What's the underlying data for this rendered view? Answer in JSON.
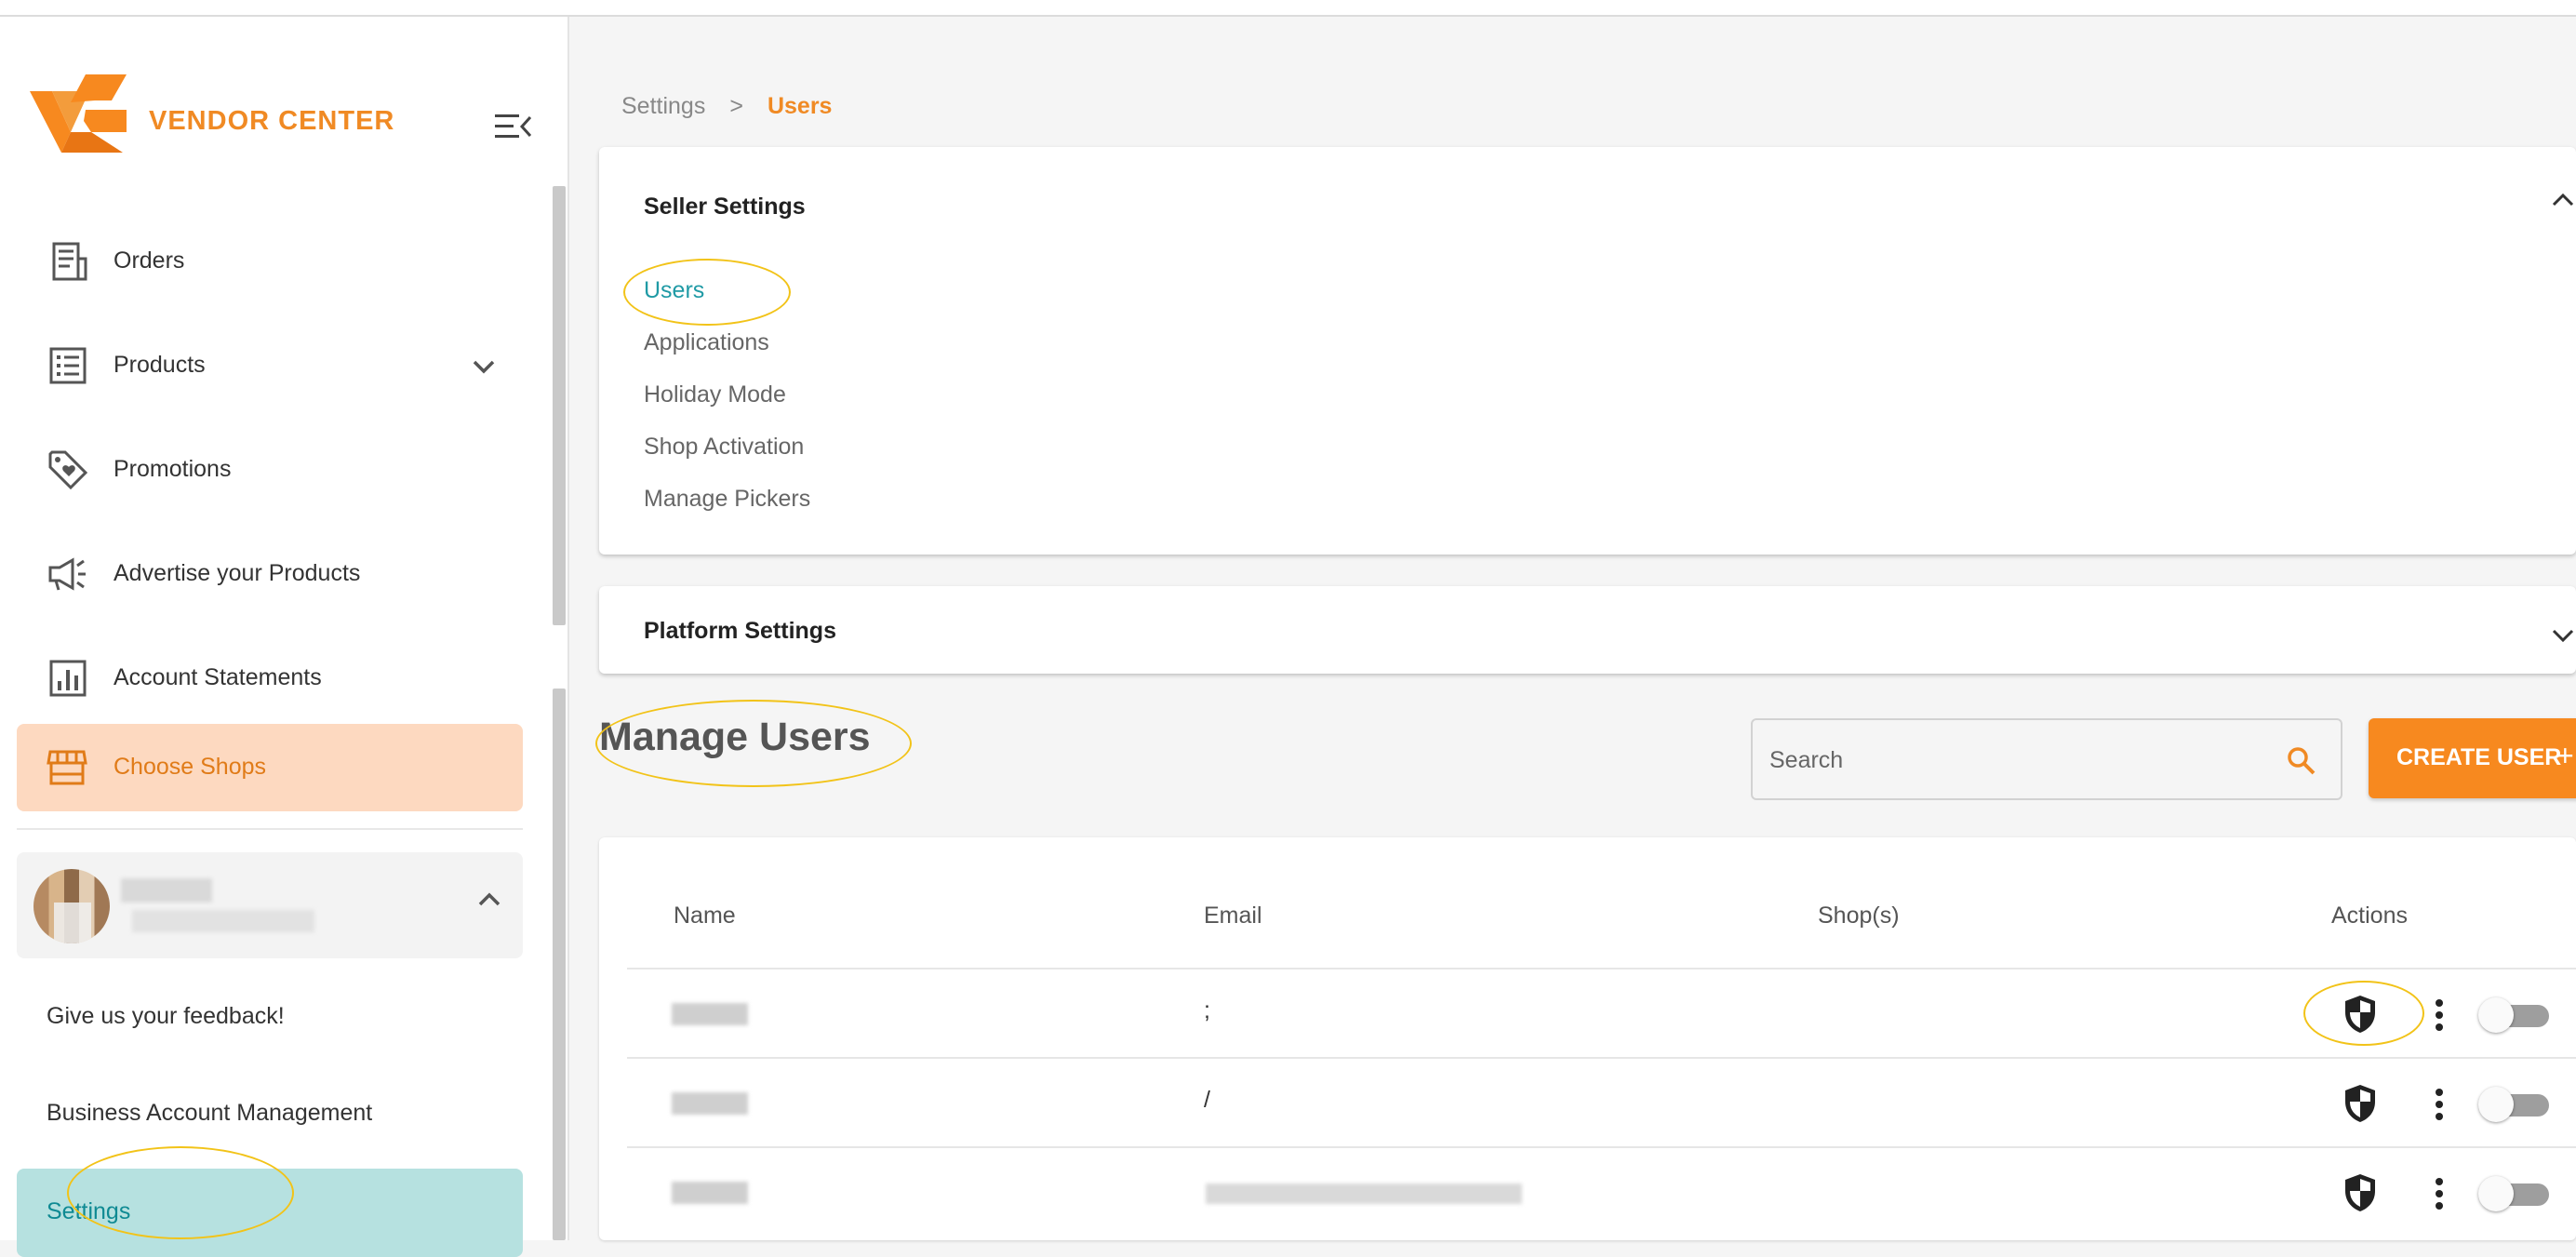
{
  "app": {
    "brand": "VENDOR CENTER",
    "accent_color": "#f08a24",
    "active_teal": "#1f9aa5"
  },
  "sidebar": {
    "toggle_icon": "menu-collapse-icon",
    "items": [
      {
        "label": "Orders",
        "icon": "receipt-icon"
      },
      {
        "label": "Products",
        "icon": "list-icon",
        "expandable": true
      },
      {
        "label": "Promotions",
        "icon": "tag-heart-icon"
      },
      {
        "label": "Advertise your Products",
        "icon": "megaphone-icon"
      },
      {
        "label": "Account Statements",
        "icon": "bar-chart-icon"
      }
    ],
    "choose_shops": {
      "label": "Choose Shops",
      "icon": "store-icon"
    },
    "links": {
      "feedback": "Give us your feedback!",
      "business": "Business Account Management",
      "settings": "Settings"
    }
  },
  "breadcrumb": {
    "parent": "Settings",
    "separator": ">",
    "current": "Users"
  },
  "seller_settings": {
    "title": "Seller Settings",
    "links": [
      "Users",
      "Applications",
      "Holiday Mode",
      "Shop Activation",
      "Manage Pickers"
    ]
  },
  "platform_settings": {
    "title": "Platform Settings"
  },
  "manage_users": {
    "title": "Manage Users",
    "search_placeholder": "Search",
    "create_label": "CREATE USER",
    "create_plus": "+",
    "columns": [
      "Name",
      "Email",
      "Shop(s)",
      "Actions"
    ],
    "rows": [
      {
        "email": ";"
      },
      {
        "email": "/"
      },
      {
        "email": ""
      }
    ]
  }
}
